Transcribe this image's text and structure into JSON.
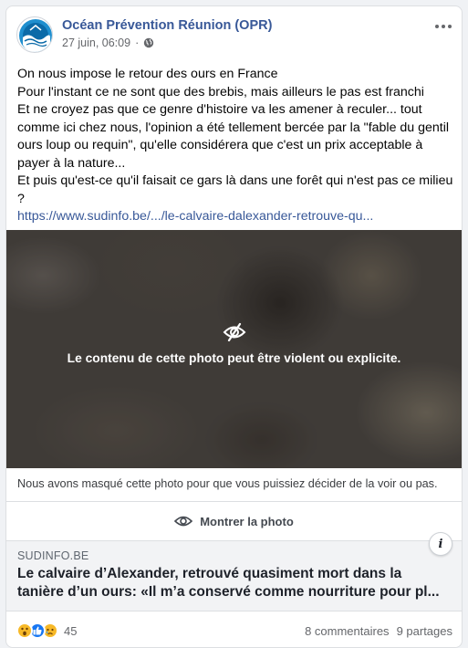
{
  "post": {
    "page_name": "Océan Prévention Réunion (OPR)",
    "date": "27 juin, 06:09",
    "separator": "·",
    "privacy_icon": "globe-icon",
    "text_lines": [
      "On nous impose le retour des ours en France",
      "Pour l'instant ce ne sont que des brebis, mais ailleurs le pas est franchi",
      "Et ne croyez pas que ce genre d'histoire va les amener à reculer... tout comme ici chez nous, l'opinion a été tellement bercée par la \"fable du gentil ours loup ou requin\", qu'elle considérera que c'est un prix acceptable à payer à la nature...",
      "Et puis qu'est-ce qu'il faisait ce gars là dans une forêt qui n'est pas ce milieu ?"
    ],
    "link": "https://www.sudinfo.be/.../le-calvaire-dalexander-retrouve-qu..."
  },
  "photo": {
    "warning": "Le contenu de cette photo peut être violent ou explicite.",
    "hidden_note": "Nous avons masqué cette photo pour que vous puissiez décider de la voir ou pas.",
    "show_label": "Montrer la photo"
  },
  "link_preview": {
    "domain": "SUDINFO.BE",
    "title_line1": "Le calvaire d’Alexander, retrouvé quasiment mort dans la",
    "title_line2": "tanière d’un ours: «Il m’a conservé comme nourriture pour pl...",
    "info_label": "i"
  },
  "footer": {
    "reaction_icons": [
      "wow-icon",
      "like-icon",
      "sad-icon"
    ],
    "reaction_count": "45",
    "comments": "8 commentaires",
    "shares": "9 partages"
  },
  "colors": {
    "link": "#385898",
    "like": "#1877f2",
    "reaction_yellow": "#f7b928"
  }
}
